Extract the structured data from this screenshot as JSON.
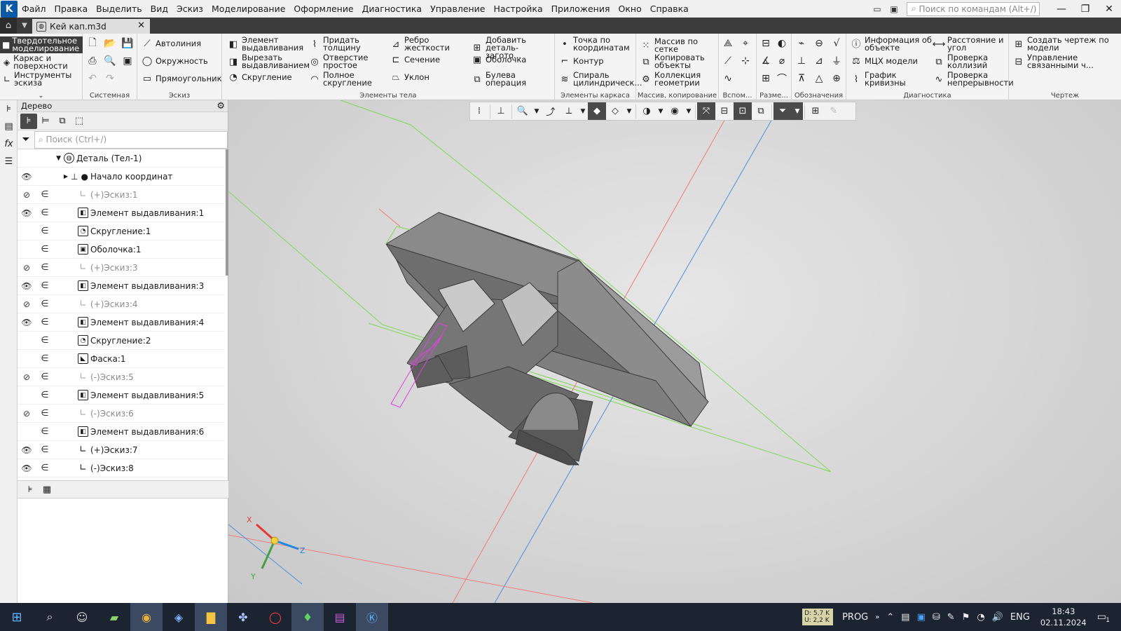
{
  "menubar": {
    "items": [
      "Файл",
      "Правка",
      "Выделить",
      "Вид",
      "Эскиз",
      "Моделирование",
      "Оформление",
      "Диагностика",
      "Управление",
      "Настройка",
      "Приложения",
      "Окно",
      "Справка"
    ],
    "search_placeholder": "Поиск по командам (Alt+/)"
  },
  "tabs": {
    "document": "Кей кап.m3d"
  },
  "ribbon": {
    "modes": [
      "Твердотельное моделирование",
      "Каркас и поверхности",
      "Инструменты эскиза"
    ],
    "groups": {
      "system": "Системная",
      "sketch": "Эскиз",
      "body": "Элементы тела",
      "frame": "Элементы каркаса",
      "array": "Массив, копирование",
      "aux": "Вспом...",
      "dims": "Разме...",
      "marks": "Обозначения",
      "diag": "Диагностика",
      "drawing": "Чертеж"
    },
    "sketch": [
      "Автолиния",
      "Окружность",
      "Прямоугольник"
    ],
    "body": [
      "Элемент выдавливания",
      "Вырезать выдавливанием",
      "Скругление",
      "Придать толщину",
      "Отверстие простое",
      "Полное скругление",
      "Ребро жесткости",
      "Сечение",
      "Уклон",
      "Добавить деталь-загото...",
      "Оболочка",
      "Булева операция"
    ],
    "frame": [
      "Точка по координатам",
      "Контур",
      "Спираль цилиндрическ..."
    ],
    "array": [
      "Массив по сетке",
      "Копировать объекты",
      "Коллекция геометрии"
    ],
    "diag": [
      "Информация об объекте",
      "МЦХ модели",
      "График кривизны",
      "Расстояние и угол",
      "Проверка коллизий",
      "Проверка непрерывности"
    ],
    "drawing": [
      "Создать чертеж по модели",
      "Управление связанными ч..."
    ]
  },
  "tree": {
    "title": "Дерево",
    "search_placeholder": "Поиск (Ctrl+/)",
    "root": "Деталь (Тел-1)",
    "origin": "Начало координат",
    "rows": [
      {
        "label": "(+)Эскиз:1",
        "eye": "hidden",
        "dim": true,
        "icon": "sketch"
      },
      {
        "label": "Элемент выдавливания:1",
        "eye": "visible",
        "dim": false,
        "icon": "extrude"
      },
      {
        "label": "Скругление:1",
        "eye": "none",
        "dim": false,
        "icon": "fillet"
      },
      {
        "label": "Оболочка:1",
        "eye": "none",
        "dim": false,
        "icon": "shell"
      },
      {
        "label": "(+)Эскиз:3",
        "eye": "hidden",
        "dim": true,
        "icon": "sketch"
      },
      {
        "label": "Элемент выдавливания:3",
        "eye": "visible",
        "dim": false,
        "icon": "extrude"
      },
      {
        "label": "(+)Эскиз:4",
        "eye": "hidden",
        "dim": true,
        "icon": "sketch"
      },
      {
        "label": "Элемент выдавливания:4",
        "eye": "visible",
        "dim": false,
        "icon": "extrude"
      },
      {
        "label": "Скругление:2",
        "eye": "none",
        "dim": false,
        "icon": "fillet"
      },
      {
        "label": "Фаска:1",
        "eye": "none",
        "dim": false,
        "icon": "chamfer"
      },
      {
        "label": "(-)Эскиз:5",
        "eye": "hidden",
        "dim": true,
        "icon": "sketch"
      },
      {
        "label": "Элемент выдавливания:5",
        "eye": "none",
        "dim": false,
        "icon": "extrude"
      },
      {
        "label": "(-)Эскиз:6",
        "eye": "hidden",
        "dim": true,
        "icon": "sketch"
      },
      {
        "label": "Элемент выдавливания:6",
        "eye": "none",
        "dim": false,
        "icon": "extrude"
      },
      {
        "label": "(+)Эскиз:7",
        "eye": "visible",
        "dim": false,
        "icon": "sketch"
      },
      {
        "label": "(-)Эскиз:8",
        "eye": "visible",
        "dim": false,
        "icon": "sketch"
      }
    ]
  },
  "axes": {
    "x": "X",
    "y": "Y",
    "z": "Z"
  },
  "taskbar": {
    "tray_text": "PROG",
    "lang": "ENG",
    "time": "18:43",
    "date": "02.11.2024",
    "notif": "1",
    "net_d": "D: 5,7 K",
    "net_u": "U: 2,2 K"
  },
  "colors": {
    "accent": "#0c5aa6",
    "tree_dim": "#8c8c8c",
    "taskbar": "#1c2431"
  }
}
